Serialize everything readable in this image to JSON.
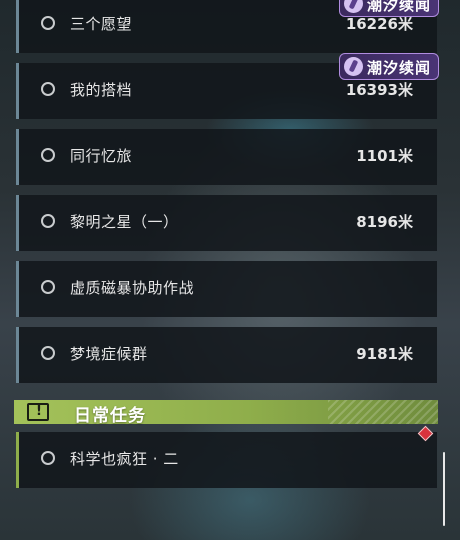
{
  "quests": [
    {
      "name": "三个愿望",
      "distance": "16226米"
    },
    {
      "name": "我的搭档",
      "distance": "16393米"
    },
    {
      "name": "同行忆旅",
      "distance": "1101米"
    },
    {
      "name": "黎明之星（一）",
      "distance": "8196米"
    },
    {
      "name": "虚质磁暴协助作战",
      "distance": ""
    },
    {
      "name": "梦境症候群",
      "distance": "9181米"
    }
  ],
  "badges": [
    {
      "label": "潮汐续闻"
    },
    {
      "label": "潮汐续闻"
    }
  ],
  "daily_section": {
    "title": "日常任务",
    "icon_glyph": "!"
  },
  "daily_quests": [
    {
      "name": "科学也疯狂 · 二",
      "distance": ""
    }
  ],
  "colors": {
    "section_accent": "#a4c25a",
    "badge_accent": "#b08cdf",
    "marker": "#d8323c"
  }
}
